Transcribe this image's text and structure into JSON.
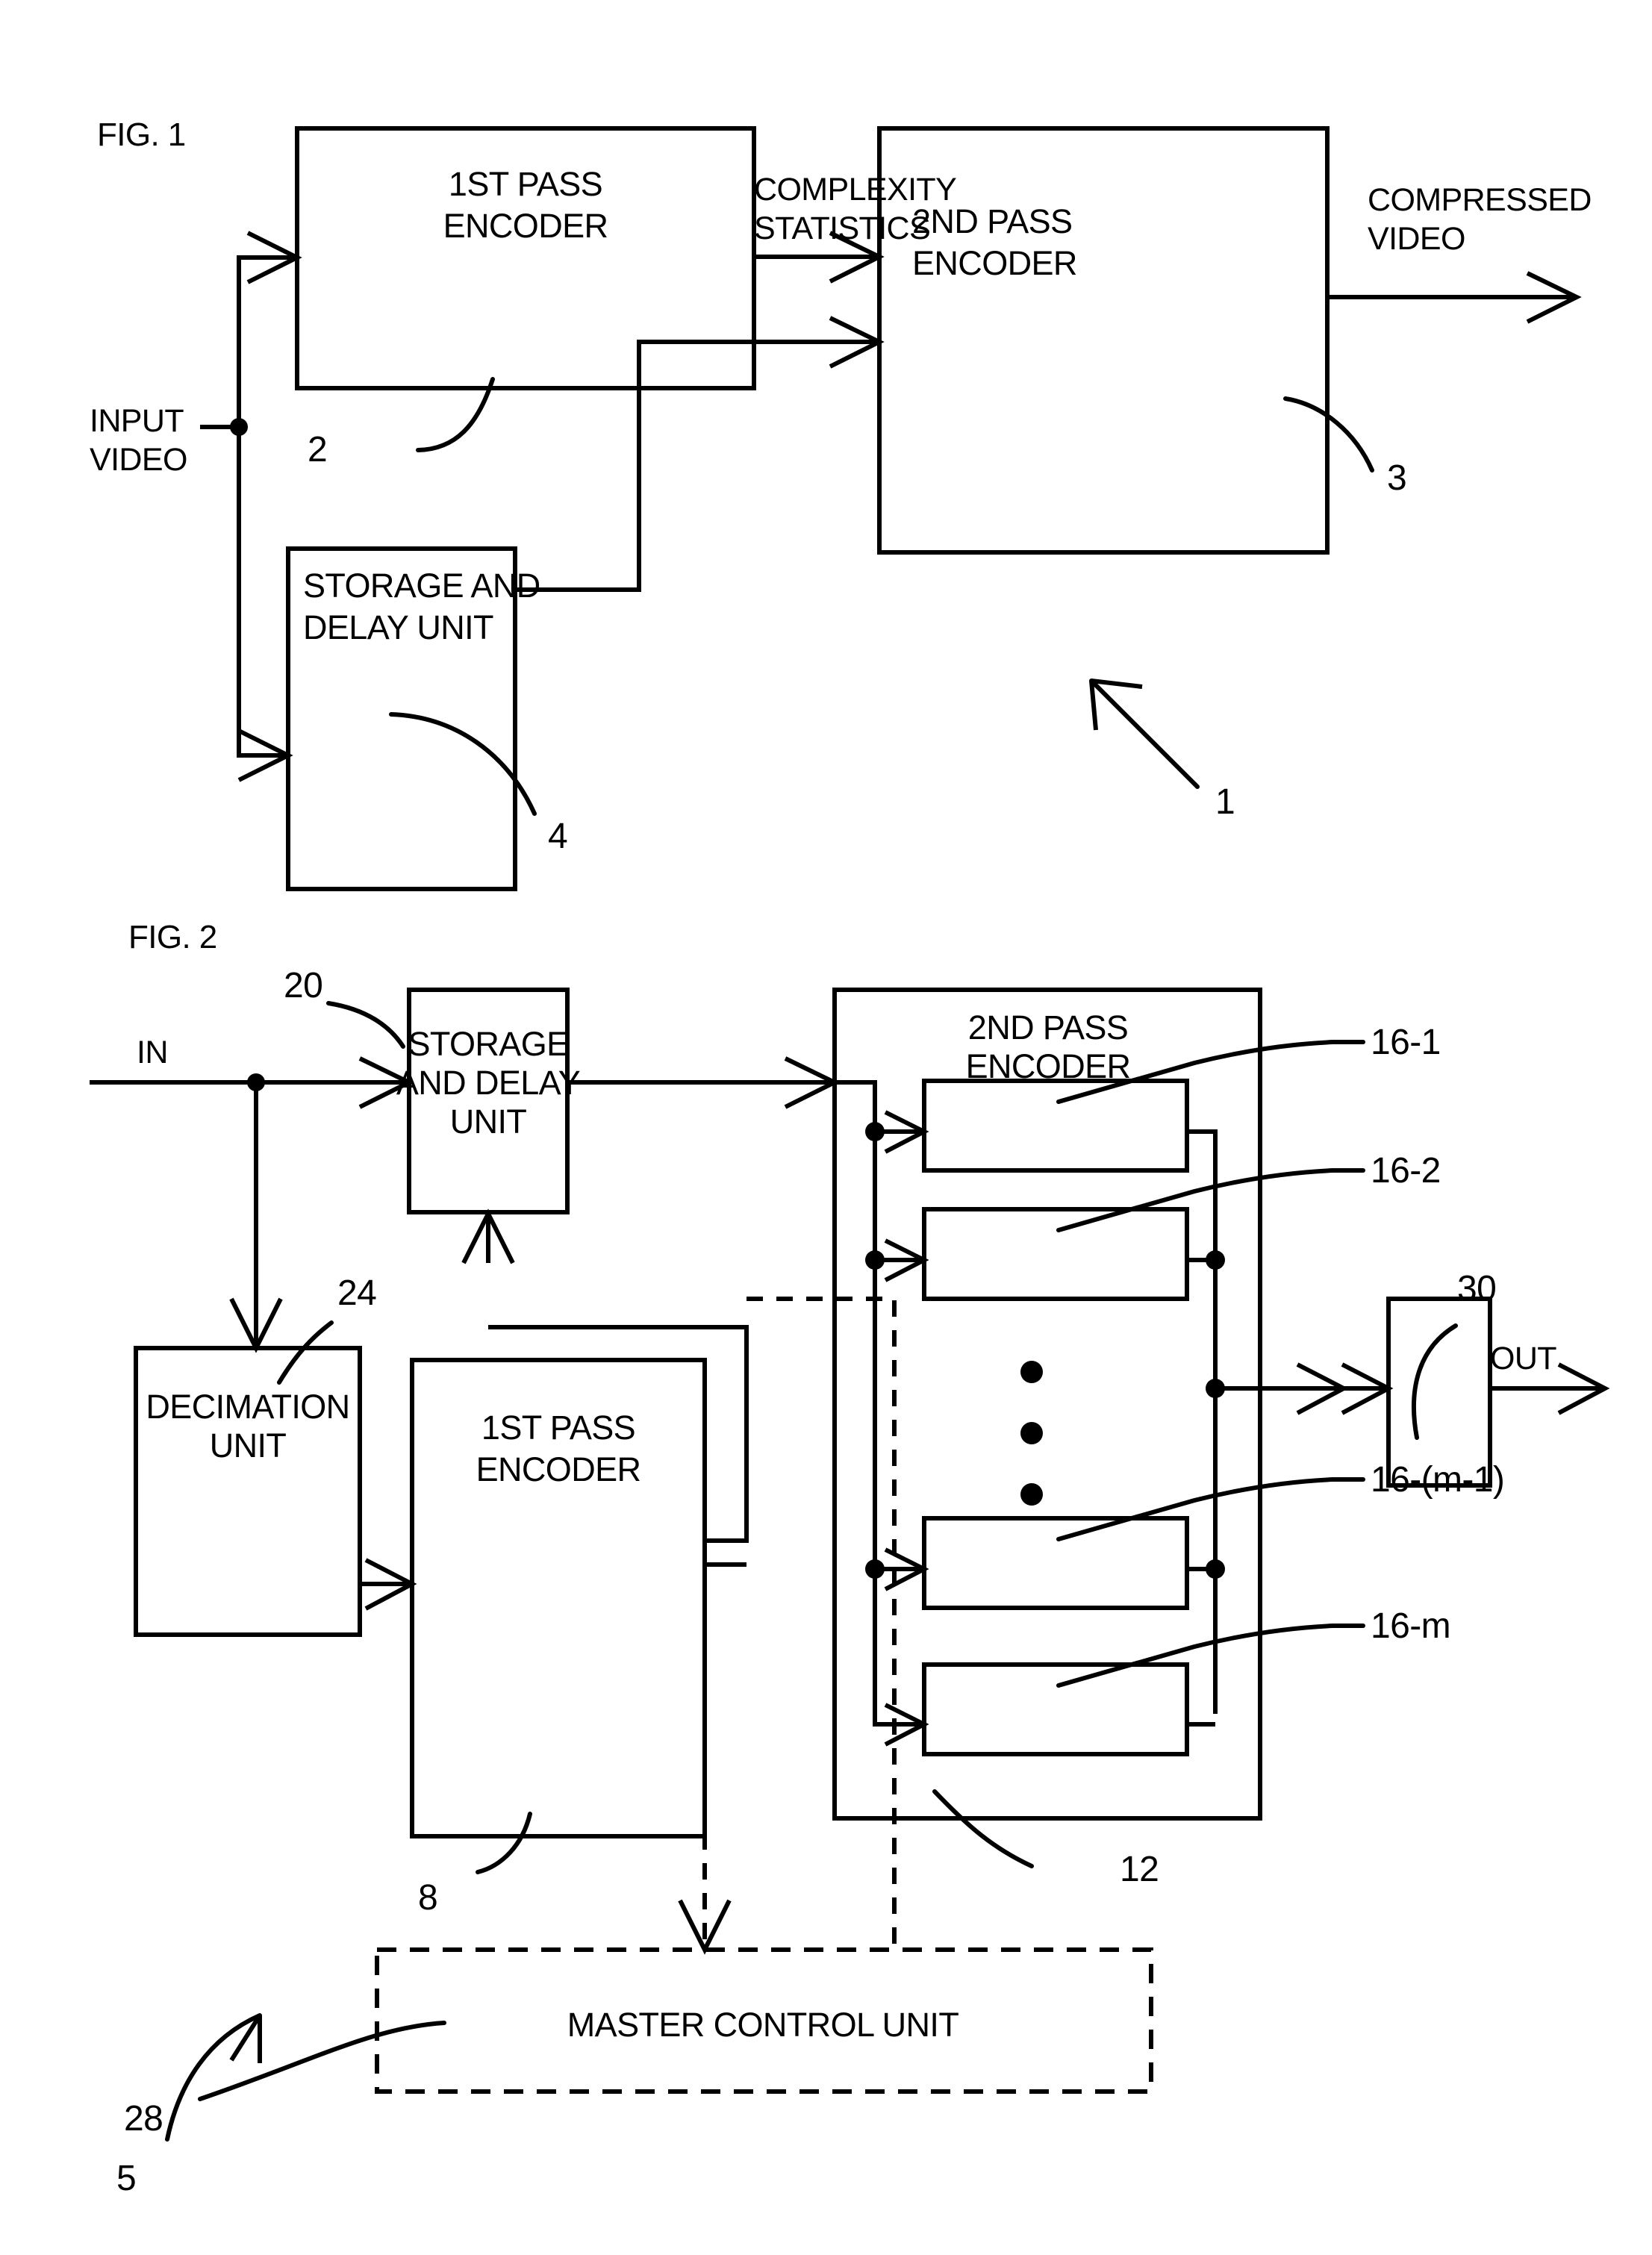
{
  "document": {
    "type": "patent-drawing-sheet",
    "figures": [
      {
        "id": "fig1",
        "label": "FIG. 1",
        "system_ref": "1",
        "boxes": [
          {
            "id": "fig1-first-pass",
            "label_line1": "1ST PASS",
            "label_line2": "ENCODER",
            "ref": "2"
          },
          {
            "id": "fig1-second-pass",
            "label_line1": "2ND PASS",
            "label_line2": "ENCODER",
            "ref": "3"
          },
          {
            "id": "fig1-storage-delay",
            "label_line1": "STORAGE AND",
            "label_line2": "DELAY UNIT",
            "ref": "4"
          }
        ],
        "signals": [
          {
            "id": "fig1-input-video",
            "line1": "INPUT",
            "line2": "VIDEO"
          },
          {
            "id": "fig1-complexity-statistics",
            "line1": "COMPLEXITY",
            "line2": "STATISTICS"
          },
          {
            "id": "fig1-compressed-video",
            "line1": "COMPRESSED",
            "line2": "VIDEO"
          }
        ]
      },
      {
        "id": "fig2",
        "label": "FIG. 2",
        "system_ref": "5",
        "boxes": [
          {
            "id": "fig2-storage-delay",
            "label_line1": "STORAGE",
            "label_line2": "AND DELAY",
            "label_line3": "UNIT",
            "ref": "20"
          },
          {
            "id": "fig2-decimation-unit",
            "label_line1": "DECIMATION",
            "label_line2": "UNIT",
            "ref": "24"
          },
          {
            "id": "fig2-first-pass",
            "label_line1": "1ST PASS",
            "label_line2": "ENCODER",
            "ref": "8"
          },
          {
            "id": "fig2-second-pass",
            "label_line1": "2ND PASS",
            "label_line2": "ENCODER",
            "ref": "12"
          },
          {
            "id": "fig2-combiner",
            "label_line1": "",
            "ref": "30"
          },
          {
            "id": "fig2-master-control",
            "label_line1": "MASTER CONTROL UNIT",
            "ref": "28"
          }
        ],
        "encoder_slices": [
          {
            "id": "fig2-encoder-16-1",
            "ref": "16-1"
          },
          {
            "id": "fig2-encoder-16-2",
            "ref": "16-2"
          },
          {
            "id": "fig2-encoder-16-m-1",
            "ref": "16-(m-1)"
          },
          {
            "id": "fig2-encoder-16-m",
            "ref": "16-m"
          }
        ],
        "signals": [
          {
            "id": "fig2-in",
            "line1": "IN"
          },
          {
            "id": "fig2-out",
            "line1": "OUT"
          }
        ],
        "ellipsis": "vertical-three-dots"
      }
    ],
    "colors": {
      "ink": "#000000",
      "paper": "#ffffff"
    }
  },
  "fig1": {
    "label": "FIG. 1",
    "input_video_l1": "INPUT",
    "input_video_l2": "VIDEO",
    "first_pass_l1": "1ST PASS",
    "first_pass_l2": "ENCODER",
    "complexity_l1": "COMPLEXITY",
    "complexity_l2": "STATISTICS",
    "second_pass_l1": "2ND PASS",
    "second_pass_l2": "ENCODER",
    "compressed_l1": "COMPRESSED",
    "compressed_l2": "VIDEO",
    "storage_l1": "STORAGE AND",
    "storage_l2": "DELAY UNIT",
    "ref_2": "2",
    "ref_3": "3",
    "ref_4": "4",
    "ref_1": "1"
  },
  "fig2": {
    "label": "FIG. 2",
    "in": "IN",
    "out": "OUT",
    "storage_l1": "STORAGE",
    "storage_l2": "AND DELAY",
    "storage_l3": "UNIT",
    "decimation_l1": "DECIMATION",
    "decimation_l2": "UNIT",
    "first_pass_l1": "1ST PASS",
    "first_pass_l2": "ENCODER",
    "second_pass_l1": "2ND PASS",
    "second_pass_l2": "ENCODER",
    "master_control": "MASTER CONTROL UNIT",
    "ref_20": "20",
    "ref_24": "24",
    "ref_8": "8",
    "ref_12": "12",
    "ref_30": "30",
    "ref_28": "28",
    "ref_5": "5",
    "ref_16_1": "16-1",
    "ref_16_2": "16-2",
    "ref_16_m1": "16-(m-1)",
    "ref_16_m": "16-m"
  }
}
